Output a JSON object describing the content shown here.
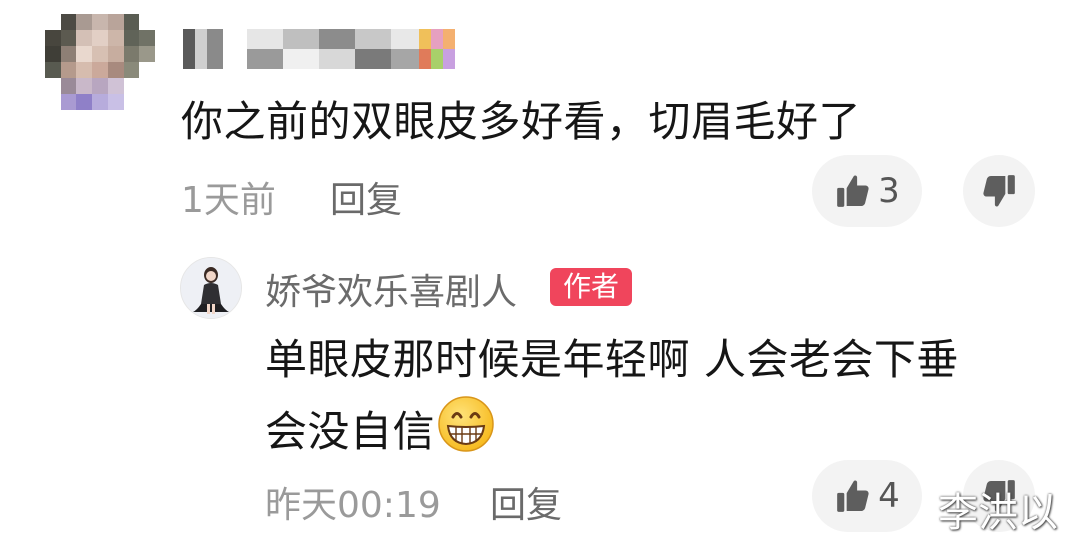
{
  "comment": {
    "text": "你之前的双眼皮多好看，切眉毛好了",
    "time": "1天前",
    "reply_label": "回复",
    "like_count": "3"
  },
  "reply": {
    "author_name": "娇爷欢乐喜剧人",
    "author_badge": "作者",
    "text_line1": "单眼皮那时候是年轻啊 人会老会下垂",
    "text_line2": "会没自信",
    "emoji": "grinning-face-emoji",
    "time": "昨天00:19",
    "reply_label": "回复",
    "like_count": "4"
  },
  "watermark": "李洪以",
  "icons": {
    "like": "thumbs-up-icon",
    "dislike": "thumbs-down-icon"
  },
  "colors": {
    "badge": "#f0455c",
    "text": "#161616",
    "meta": "#9a9a9a",
    "pill": "#f3f3f3"
  }
}
